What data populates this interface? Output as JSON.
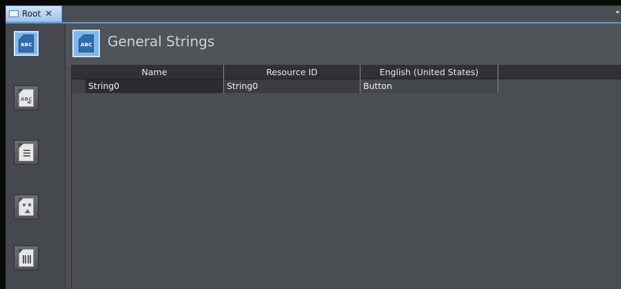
{
  "tab": {
    "label": "Root",
    "close_glyph": "✕",
    "icon": "window-icon"
  },
  "sidebar": {
    "items": [
      {
        "name": "general-strings",
        "icon": "abc-document-icon",
        "glyph": "ABC",
        "active": true
      },
      {
        "name": "audio-strings",
        "icon": "abc-speaker-document-icon",
        "glyph": "ABC",
        "active": false
      },
      {
        "name": "lists",
        "icon": "list-document-icon",
        "active": false
      },
      {
        "name": "shapes",
        "icon": "shapes-document-icon",
        "active": false
      },
      {
        "name": "images",
        "icon": "image-document-icon",
        "active": false
      }
    ]
  },
  "header": {
    "title": "General Strings",
    "icon": "abc-document-icon",
    "icon_glyph": "ABC"
  },
  "table": {
    "columns": [
      "Name",
      "Resource ID",
      "English (United States)"
    ],
    "rows": [
      [
        "String0",
        "String0",
        "Button"
      ]
    ]
  },
  "colors": {
    "accent": "#7fb8ee",
    "background": "#4c4f53",
    "tab_underline": "#5aa0e0"
  }
}
